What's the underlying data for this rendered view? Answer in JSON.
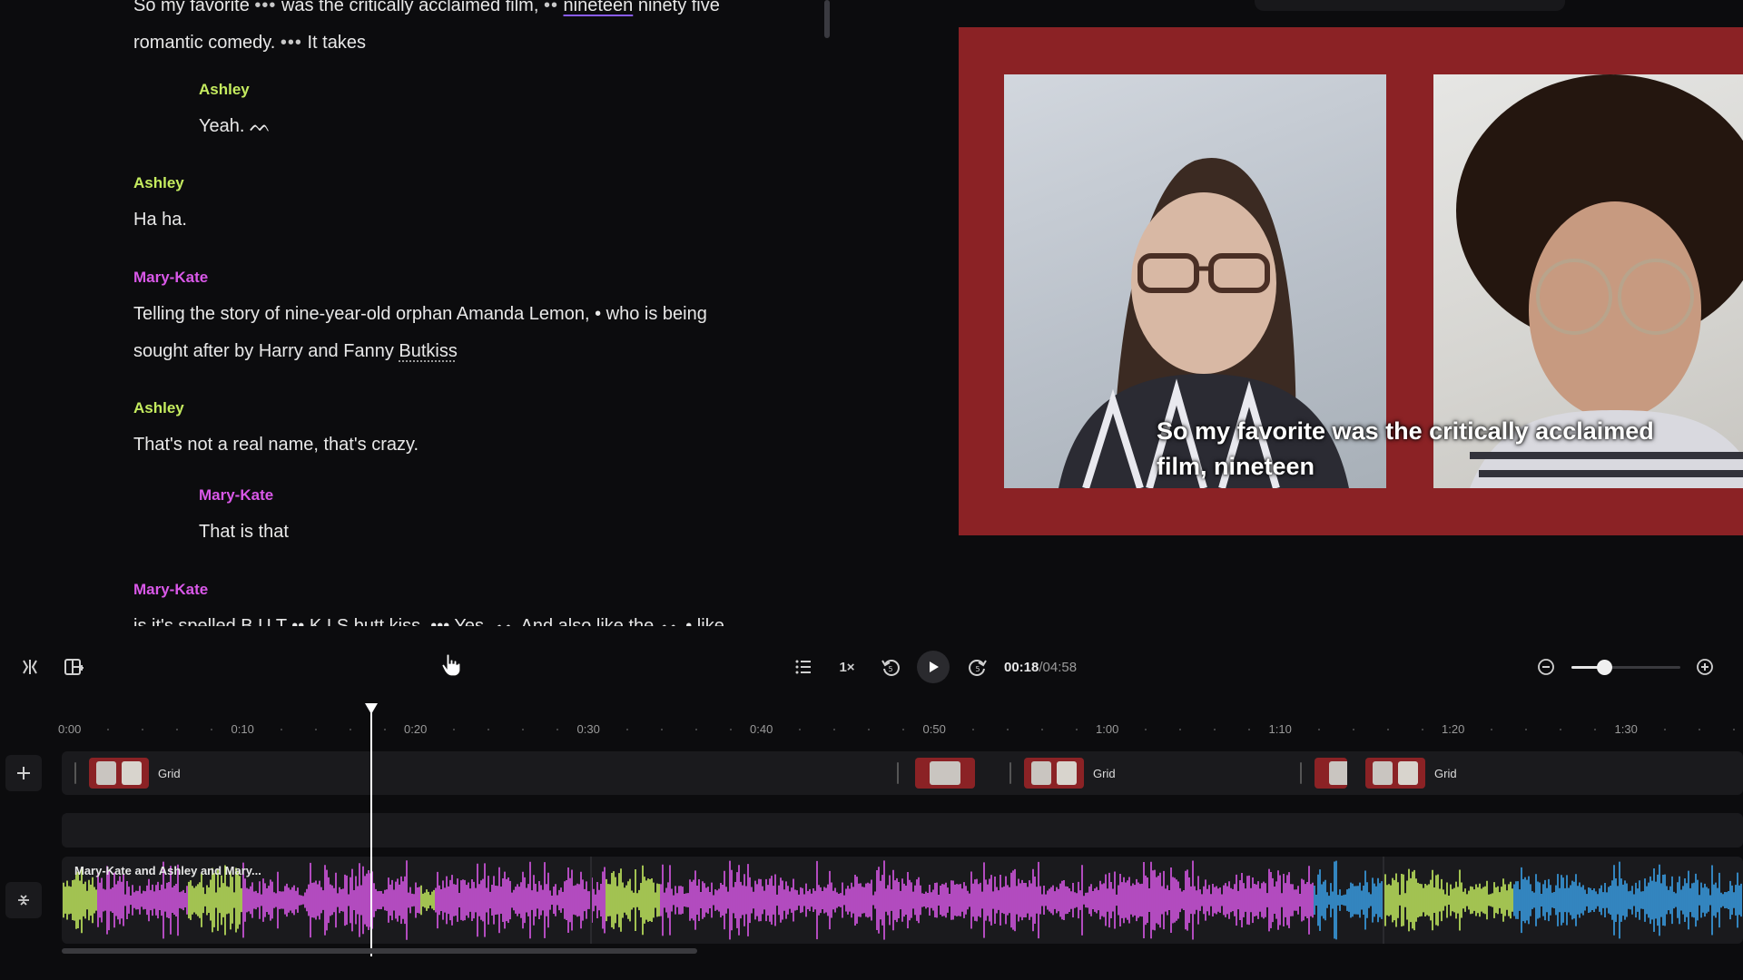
{
  "transcript": {
    "blocks": [
      {
        "speaker": "",
        "text_before": "So my favorite ",
        "pause1": "•••",
        "text_mid": " was the critically acclaimed film, ",
        "pause2": "••",
        "underlined": "nineteen",
        "text_after": " ninety five",
        "line2": "romantic comedy. ",
        "pause3": "•••",
        "line2_end": " It takes"
      },
      {
        "speaker": "Ashley",
        "text": "Yeah. ᨓ"
      },
      {
        "speaker": "Ashley",
        "text": "Ha ha."
      },
      {
        "speaker": "Mary-Kate",
        "text": "Telling the story of nine-year-old orphan Amanda Lemon, • who is being",
        "line2_before": "sought after by Harry and Fanny ",
        "dotted": "Butkiss"
      },
      {
        "speaker": "Ashley",
        "text": "That's not a real name, that's crazy."
      },
      {
        "speaker": "Mary-Kate",
        "text": "That is that"
      },
      {
        "speaker": "Mary-Kate",
        "text": "is it's spelled B U T •• K I S butt kiss. ••• Yes. ᨓ And also like the ᨓ • like"
      }
    ]
  },
  "preview": {
    "caption": "So my favorite was the critically acclaimed film, nineteen",
    "background_color": "#8b2225"
  },
  "toolbar": {
    "speed": "1×",
    "current_time": "00:18",
    "total_time": "/04:58",
    "zoom_level": 0.3
  },
  "timeline": {
    "ticks": [
      "0:00",
      "0:10",
      "0:20",
      "0:30",
      "0:40",
      "0:50",
      "1:00",
      "1:10",
      "1:20",
      "1:30"
    ],
    "clips": [
      {
        "label": "Grid"
      },
      {
        "label": ""
      },
      {
        "label": "Grid"
      },
      {
        "label": ""
      },
      {
        "label": "Grid"
      }
    ],
    "audio_label": "Mary-Kate and Ashley and Mary...",
    "colors": {
      "ashley": "#c5ec5f",
      "mary_kate": "#d958e8",
      "other": "#3aa0e8"
    }
  }
}
